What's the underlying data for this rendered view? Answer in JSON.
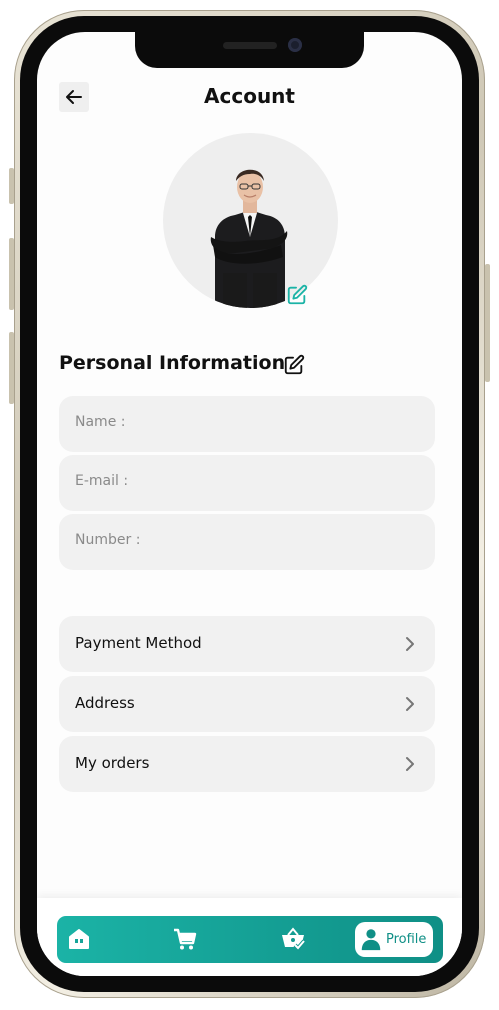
{
  "header": {
    "title": "Account",
    "back_icon": "arrow-left-icon"
  },
  "profile": {
    "avatar_icon": "user-photo",
    "edit_icon": "edit-pencil-icon"
  },
  "personal_info": {
    "title": "Personal Information",
    "edit_icon": "edit-pencil-icon",
    "fields": [
      {
        "label": "Name :",
        "value": ""
      },
      {
        "label": "E-mail :",
        "value": ""
      },
      {
        "label": "Number :",
        "value": ""
      }
    ]
  },
  "menu": {
    "items": [
      {
        "label": "Payment Method",
        "icon": "chevron-right-icon"
      },
      {
        "label": "Address",
        "icon": "chevron-right-icon"
      },
      {
        "label": "My orders",
        "icon": "chevron-right-icon"
      }
    ]
  },
  "bottom_nav": {
    "items": [
      {
        "icon": "home-icon"
      },
      {
        "icon": "cart-icon"
      },
      {
        "icon": "basket-check-icon"
      },
      {
        "icon": "user-icon",
        "label": "Profile",
        "active": true
      }
    ]
  },
  "colors": {
    "accent": "#1bb3a6",
    "accent_dark": "#0f8f86",
    "field_bg": "#f1f1f1"
  }
}
